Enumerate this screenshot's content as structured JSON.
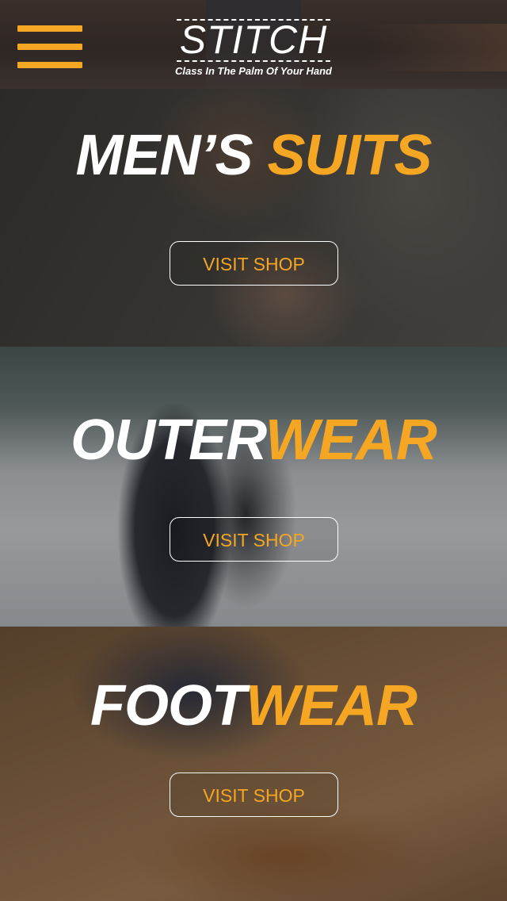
{
  "header": {
    "brand": "STITCH",
    "tagline": "Class In The Palm Of Your Hand",
    "menu_icon": "hamburger-menu-icon"
  },
  "sections": [
    {
      "title_white": "MEN’S ",
      "title_orange": "SUITS",
      "button_label": "VISIT SHOP"
    },
    {
      "title_white": "OUTER",
      "title_orange": "WEAR",
      "button_label": "VISIT SHOP"
    },
    {
      "title_white": "FOOT",
      "title_orange": "WEAR",
      "button_label": "VISIT SHOP"
    }
  ],
  "colors": {
    "accent": "#f5a623",
    "text": "#ffffff"
  }
}
